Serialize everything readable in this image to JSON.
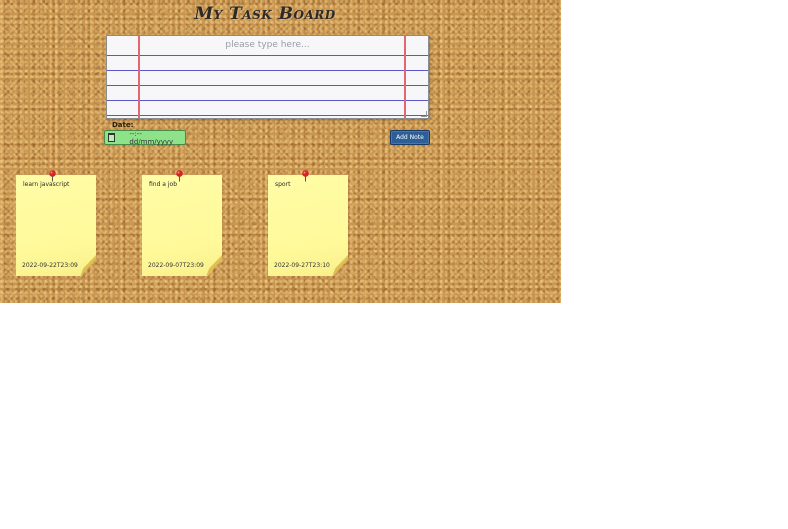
{
  "app": {
    "title": "My Task Board"
  },
  "form": {
    "textarea_placeholder": "please type here...",
    "textarea_value": "",
    "date_label": "Date:",
    "date_placeholder": "--:--  dd/mm/yyyy",
    "add_button_label": "Add Note"
  },
  "notes": [
    {
      "text": "learn javascript",
      "date": "2022-09-22T23:09"
    },
    {
      "text": "find a job",
      "date": "2022-09-07T23:09"
    },
    {
      "text": "sport",
      "date": "2022-09-27T23:10"
    }
  ],
  "icons": {
    "calendar": "calendar-icon",
    "pin": "pushpin-icon"
  },
  "colors": {
    "board": "#c9954f",
    "note": "#fffca6",
    "button": "#2d5e96",
    "date_field": "#8ee28a",
    "pin": "#d92424"
  }
}
